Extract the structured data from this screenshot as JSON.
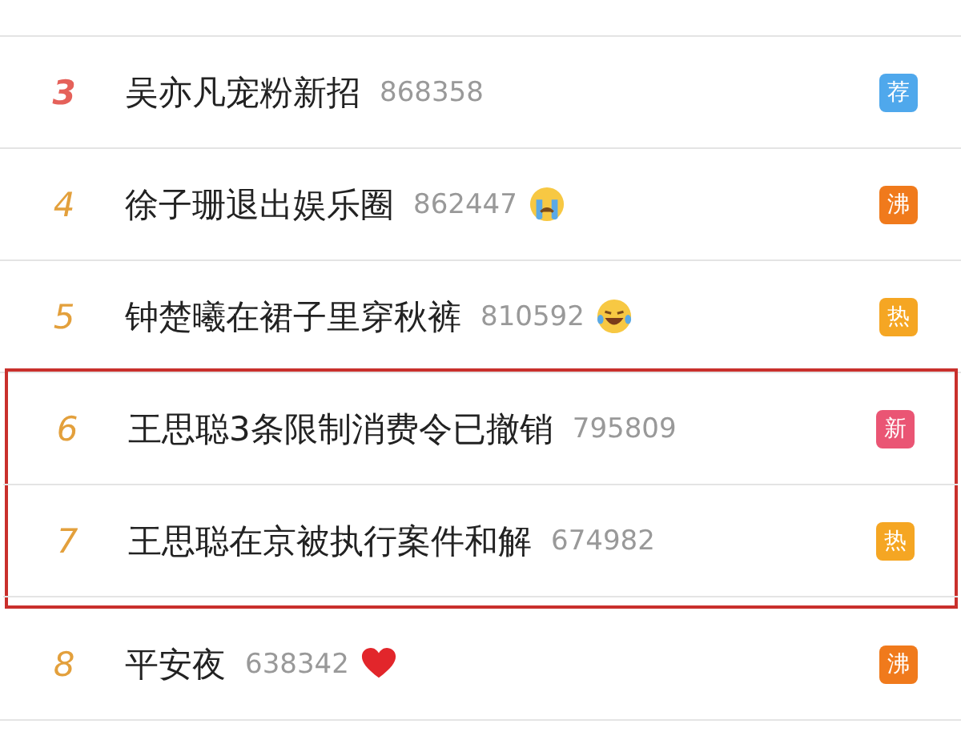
{
  "rows": [
    {
      "kind": "plain",
      "rank": "3",
      "top_rank": true,
      "title": "吴亦凡宠粉新招",
      "count": "868358",
      "tag": {
        "label": "荐",
        "color": "#4fa8ec"
      },
      "highlighted": false
    },
    {
      "kind": "crying",
      "rank": "4",
      "top_rank": false,
      "title": "徐子珊退出娱乐圈",
      "count": "862447",
      "tag": {
        "label": "沸",
        "color": "#f07a1c"
      },
      "highlighted": false
    },
    {
      "kind": "laughing",
      "rank": "5",
      "top_rank": false,
      "title": "钟楚曦在裙子里穿秋裤",
      "count": "810592",
      "tag": {
        "label": "热",
        "color": "#f5a623"
      },
      "highlighted": false
    },
    {
      "kind": "plain",
      "rank": "6",
      "top_rank": false,
      "title": "王思聪3条限制消费令已撤销",
      "count": "795809",
      "tag": {
        "label": "新",
        "color": "#ea5574"
      },
      "highlighted": true
    },
    {
      "kind": "plain",
      "rank": "7",
      "top_rank": false,
      "title": "王思聪在京被执行案件和解",
      "count": "674982",
      "tag": {
        "label": "热",
        "color": "#f5a623"
      },
      "highlighted": true
    },
    {
      "kind": "heart",
      "rank": "8",
      "top_rank": false,
      "title": "平安夜",
      "count": "638342",
      "tag": {
        "label": "沸",
        "color": "#f07a1c"
      },
      "highlighted": false
    }
  ]
}
